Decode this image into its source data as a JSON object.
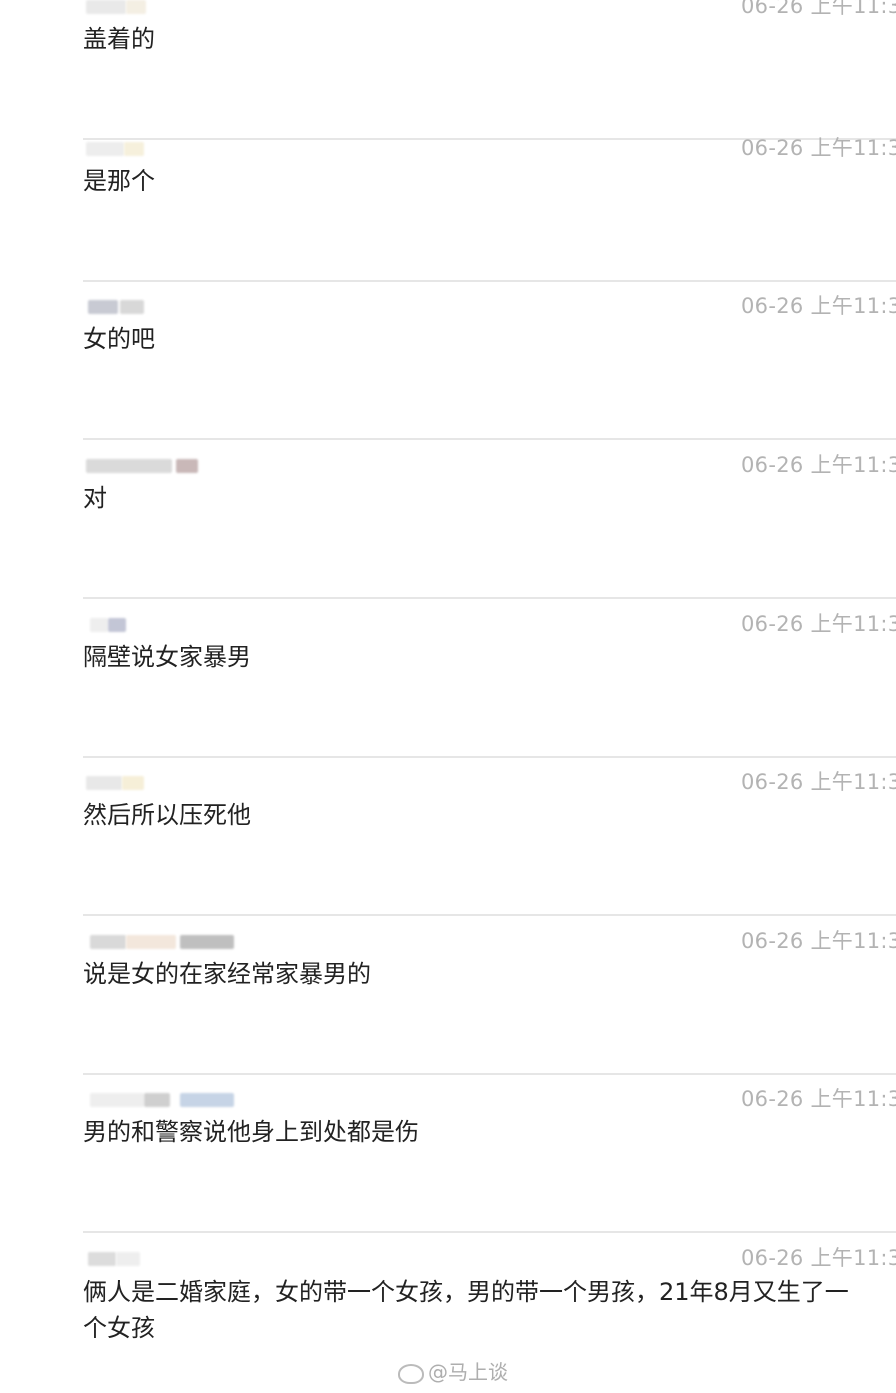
{
  "comments": [
    {
      "time": "06-26 上午11:3",
      "text": "盖着的",
      "avatar_colors": [
        "#e9e9e9",
        "#f4efe3"
      ]
    },
    {
      "time": "06-26 上午11:3",
      "text": "是那个",
      "avatar_colors": [
        "#ededed",
        "#f6f0dc"
      ]
    },
    {
      "time": "06-26 上午11:3",
      "text": "女的吧",
      "avatar_colors": [
        "#c8cad3",
        "#d8d8d8"
      ]
    },
    {
      "time": "06-26 上午11:3",
      "text": "对",
      "avatar_colors": [
        "#dadada",
        "#c9b8b8"
      ]
    },
    {
      "time": "06-26 上午11:3",
      "text": "隔壁说女家暴男",
      "avatar_colors": [
        "#eeeeee",
        "#c3c6d6"
      ]
    },
    {
      "time": "06-26 上午11:3",
      "text": "然后所以压死他",
      "avatar_colors": [
        "#e8e8e8",
        "#f6efd8"
      ]
    },
    {
      "time": "06-26 上午11:3",
      "text": "说是女的在家经常家暴男的",
      "avatar_colors": [
        "#d9d9d9",
        "#f3e7dc",
        "#bfbfbf"
      ]
    },
    {
      "time": "06-26 上午11:3",
      "text": "男的和警察说他身上到处都是伤",
      "avatar_colors": [
        "#eeeeee",
        "#cfcfcf",
        "#c6d4e6"
      ]
    },
    {
      "time": "06-26 上午11:3",
      "text": "俩人是二婚家庭，女的带一个女孩，男的带一个男孩，21年8月又生了一个女孩",
      "avatar_colors": [
        "#dcdcdc",
        "#eeeeee"
      ]
    }
  ],
  "watermark": {
    "text": "@马上谈"
  }
}
